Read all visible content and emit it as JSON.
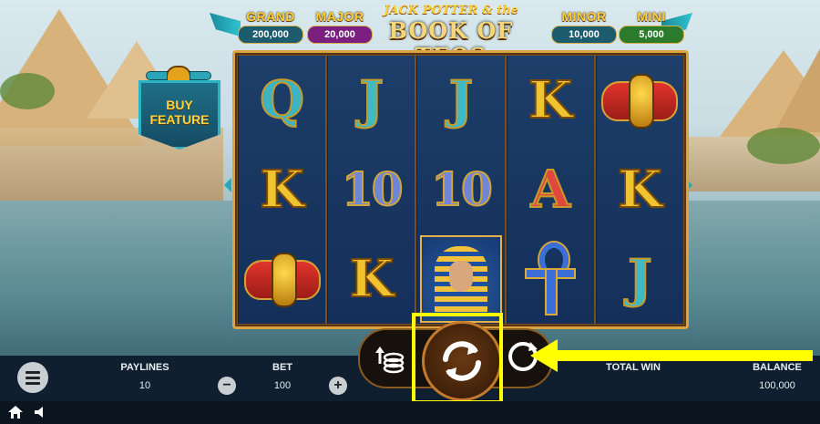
{
  "jackpots": [
    {
      "label": "GRAND",
      "value": "200,000",
      "color": "#1d5b6e"
    },
    {
      "label": "MAJOR",
      "value": "20,000",
      "color": "#7a1f7f"
    },
    {
      "label": "MINOR",
      "value": "10,000",
      "color": "#1d5b6e"
    },
    {
      "label": "MINI",
      "value": "5,000",
      "color": "#2c7a2c"
    }
  ],
  "logo": {
    "top": "JACK POTTER & the",
    "main": "BOOK OF TEOS"
  },
  "buy_feature": {
    "line1": "BUY",
    "line2": "FEATURE"
  },
  "reels": [
    [
      "Q",
      "K",
      "scarab"
    ],
    [
      "J",
      "10",
      "K"
    ],
    [
      "J",
      "10",
      "pharaoh"
    ],
    [
      "K",
      "A",
      "ankh"
    ],
    [
      "scarab",
      "K",
      "J"
    ]
  ],
  "controls": {
    "paylines_label": "PAYLINES",
    "paylines_value": "10",
    "bet_label": "BET",
    "bet_value": "100",
    "minus": "−",
    "plus": "+",
    "total_win_label": "TOTAL WIN",
    "balance_label": "BALANCE",
    "balance_value": "100,000"
  },
  "colors": {
    "highlight": "#ffff00",
    "accent": "#c47a2a"
  }
}
